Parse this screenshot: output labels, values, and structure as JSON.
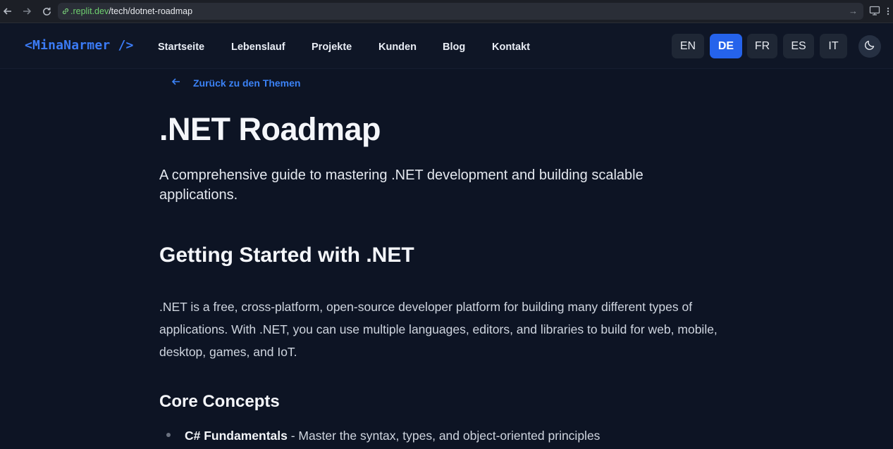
{
  "browser": {
    "url_domain": ".replit.dev",
    "url_path": "/tech/dotnet-roadmap"
  },
  "header": {
    "logo": "<MinaNarmer />",
    "menu": [
      "Startseite",
      "Lebenslauf",
      "Projekte",
      "Kunden",
      "Blog",
      "Kontakt"
    ],
    "languages": [
      "EN",
      "DE",
      "FR",
      "ES",
      "IT"
    ],
    "active_language": "DE"
  },
  "content": {
    "back_link": "Zurück zu den Themen",
    "title": ".NET Roadmap",
    "subtitle": "A comprehensive guide to mastering .NET development and building scalable applications.",
    "section_heading": "Getting Started with .NET",
    "paragraph": ".NET is a free, cross-platform, open-source developer platform for building many different types of applications. With .NET, you can use multiple languages, editors, and libraries to build for web, mobile, desktop, games, and IoT.",
    "subheading": "Core Concepts",
    "bullets": [
      {
        "strong": "C# Fundamentals",
        "text": " - Master the syntax, types, and object-oriented principles"
      }
    ]
  },
  "colors": {
    "accent": "#2563eb",
    "link": "#3b82f6",
    "background": "#0d1424"
  }
}
